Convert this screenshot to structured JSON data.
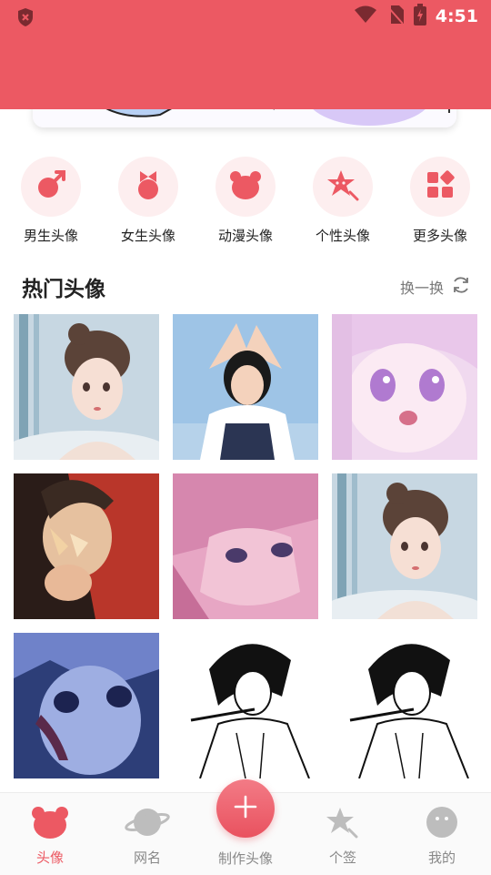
{
  "status_bar": {
    "time": "4:51"
  },
  "categories": [
    {
      "label": "男生头像",
      "icon": "male-icon"
    },
    {
      "label": "女生头像",
      "icon": "female-icon"
    },
    {
      "label": "动漫头像",
      "icon": "bear-icon"
    },
    {
      "label": "个性头像",
      "icon": "star-face-icon"
    },
    {
      "label": "更多头像",
      "icon": "grid-shapes-icon"
    }
  ],
  "hot": {
    "title": "热门头像",
    "refresh_label": "换一换"
  },
  "avatars": [
    {
      "name": "avatar-girl-hairbun"
    },
    {
      "name": "avatar-girl-heart-pose"
    },
    {
      "name": "avatar-anime-purple-hair"
    },
    {
      "name": "avatar-girl-butterfly"
    },
    {
      "name": "avatar-anime-pink-hair"
    },
    {
      "name": "avatar-girl-hairbun"
    },
    {
      "name": "avatar-anime-blue"
    },
    {
      "name": "avatar-manga-swordsman"
    },
    {
      "name": "avatar-manga-swordsman"
    }
  ],
  "bottom_nav": {
    "items": [
      {
        "label": "头像",
        "active": true
      },
      {
        "label": "网名",
        "active": false
      },
      {
        "label": "制作头像",
        "active": false
      },
      {
        "label": "个签",
        "active": false
      },
      {
        "label": "我的",
        "active": false
      }
    ]
  },
  "colors": {
    "accent": "#ec5963",
    "soft": "#fdeeef"
  }
}
